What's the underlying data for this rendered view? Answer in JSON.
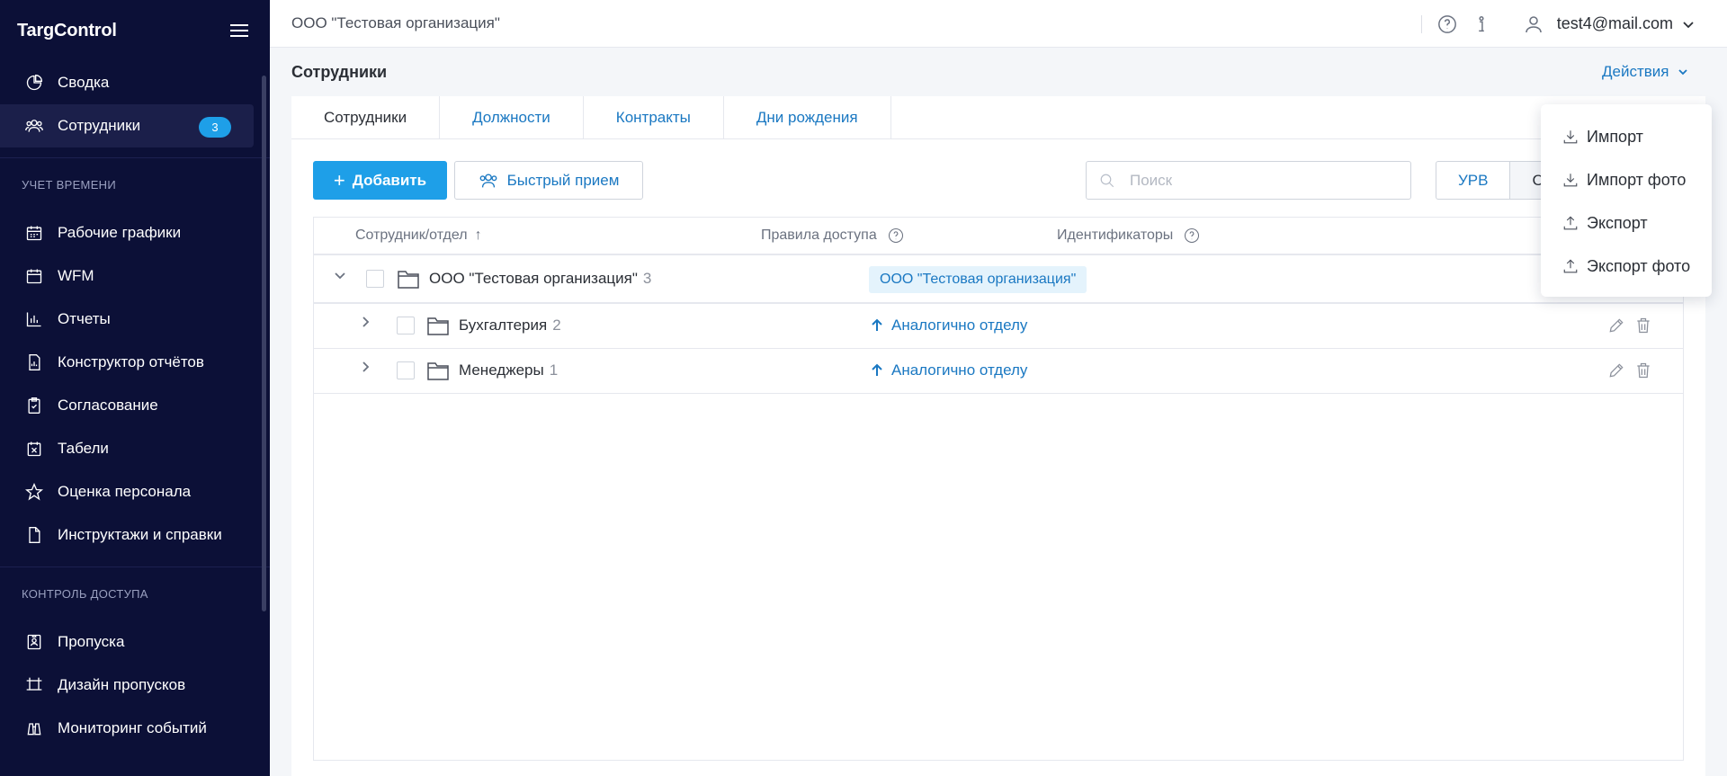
{
  "app": {
    "logo": "TargControl"
  },
  "sidebar": {
    "items": [
      {
        "label": "Сводка",
        "icon": "pie-chart-icon"
      },
      {
        "label": "Сотрудники",
        "icon": "users-icon",
        "badge": "3",
        "active": true
      }
    ],
    "section_time": "УЧЕТ ВРЕМЕНИ",
    "time_items": [
      {
        "label": "Рабочие графики",
        "icon": "calendar-grid-icon"
      },
      {
        "label": "WFM",
        "icon": "calendar-icon"
      },
      {
        "label": "Отчеты",
        "icon": "bar-chart-icon"
      },
      {
        "label": "Конструктор отчётов",
        "icon": "report-builder-icon"
      },
      {
        "label": "Согласование",
        "icon": "clipboard-check-icon"
      },
      {
        "label": "Табели",
        "icon": "calendar-x-icon"
      },
      {
        "label": "Оценка персонала",
        "icon": "star-icon"
      },
      {
        "label": "Инструктажи и справки",
        "icon": "document-icon"
      }
    ],
    "section_access": "КОНТРОЛЬ ДОСТУПА",
    "access_items": [
      {
        "label": "Пропуска",
        "icon": "id-badge-icon"
      },
      {
        "label": "Дизайн пропусков",
        "icon": "pass-design-icon"
      },
      {
        "label": "Мониторинг событий",
        "icon": "binoculars-icon"
      }
    ]
  },
  "topbar": {
    "org": "ООО \"Тестовая организация\"",
    "user_email": "test4@mail.com"
  },
  "page": {
    "title": "Сотрудники",
    "actions_label": "Действия"
  },
  "tabs": [
    "Сотрудники",
    "Должности",
    "Контракты",
    "Дни рождения"
  ],
  "toolbar": {
    "add_label": "Добавить",
    "quick_label": "Быстрый прием",
    "search_placeholder": "Поиск",
    "seg_1": "УРВ",
    "seg_2": "С"
  },
  "table": {
    "col_employee": "Сотрудник/отдел",
    "col_access": "Правила доступа",
    "col_ids": "Идентификаторы",
    "org_row": {
      "name": "ООО \"Тестовая организация\"",
      "count": "3",
      "access": "ООО \"Тестовая организация\""
    },
    "rows": [
      {
        "name": "Бухгалтерия",
        "count": "2",
        "access": "Аналогично отделу"
      },
      {
        "name": "Менеджеры",
        "count": "1",
        "access": "Аналогично отделу"
      }
    ]
  },
  "dropdown": {
    "items": [
      "Импорт",
      "Импорт фото",
      "Экспорт",
      "Экспорт фото"
    ]
  },
  "colors": {
    "sidebar_bg": "#0c1037",
    "accent": "#1e9fe8",
    "link": "#1a78c2"
  }
}
